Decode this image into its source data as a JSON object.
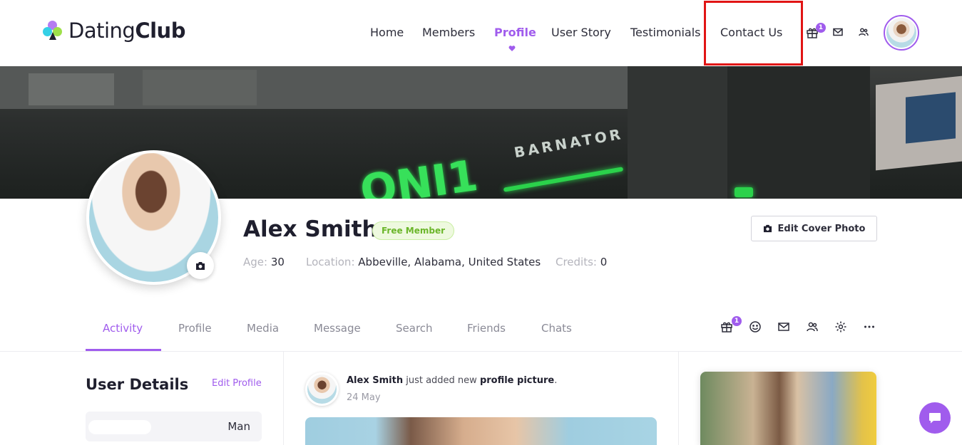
{
  "brand": {
    "name_regular": "Dating",
    "name_bold": "Club"
  },
  "nav": {
    "items": [
      {
        "label": "Home"
      },
      {
        "label": "Members"
      },
      {
        "label": "Profile",
        "active": true
      },
      {
        "label": "User Story"
      },
      {
        "label": "Testimonials"
      },
      {
        "label": "Contact Us"
      }
    ],
    "gift_badge": "1"
  },
  "profile": {
    "name": "Alex Smith",
    "membership": "Free Member",
    "age_label": "Age:",
    "age": "30",
    "location_label": "Location:",
    "location": "Abbeville, Alabama, United States",
    "credits_label": "Credits:",
    "credits": "0",
    "edit_cover_label": "Edit Cover Photo"
  },
  "tabs": [
    {
      "label": "Activity",
      "active": true
    },
    {
      "label": "Profile"
    },
    {
      "label": "Media"
    },
    {
      "label": "Message"
    },
    {
      "label": "Search"
    },
    {
      "label": "Friends"
    },
    {
      "label": "Chats"
    }
  ],
  "tab_actions": {
    "gift_badge": "1"
  },
  "user_details": {
    "title": "User Details",
    "edit_label": "Edit Profile",
    "gender_value": "Man"
  },
  "activity": {
    "actor": "Alex Smith",
    "action": " just added new ",
    "object": "profile picture",
    "suffix": ".",
    "date": "24 May"
  },
  "colors": {
    "accent": "#a05ced",
    "highlight_border": "#e11414",
    "member_badge": "#6bb62a"
  },
  "icons": [
    "gift-icon",
    "mail-icon",
    "users-icon",
    "camera-icon",
    "smile-icon",
    "settings-icon",
    "more-icon",
    "chat-icon",
    "heart-icon"
  ]
}
